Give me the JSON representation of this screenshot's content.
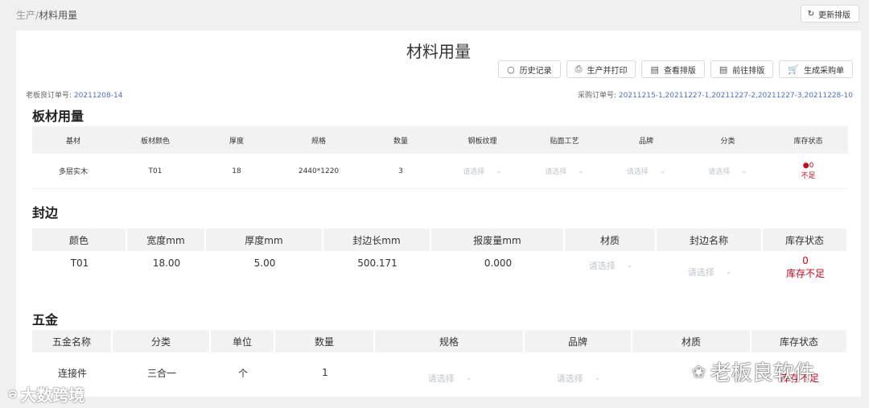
{
  "breadcrumb": {
    "parent": "生产",
    "sep": "/",
    "current": "材料用量"
  },
  "refresh_label": "更新排版",
  "page_title": "材料用量",
  "toolbar": [
    {
      "label": "历史记录",
      "icon": "history-icon",
      "glyph": "○"
    },
    {
      "label": "生产并打印",
      "icon": "printer-icon",
      "glyph": "⎙"
    },
    {
      "label": "查看排版",
      "icon": "layout-icon",
      "glyph": "▤"
    },
    {
      "label": "前往排版",
      "icon": "layout-icon",
      "glyph": "▤"
    },
    {
      "label": "生成采购单",
      "icon": "cart-icon",
      "glyph": "🛒"
    }
  ],
  "order": {
    "label": "老板良订单号:",
    "value": "20211208-14",
    "purchase_label": "采购订单号:",
    "purchase_value": "20211215-1,20211227-1,20211227-2,20211227-3,20211228-10"
  },
  "board": {
    "title": "板材用量",
    "headers": [
      "基材",
      "板材颜色",
      "厚度",
      "规格",
      "数量",
      "钢板纹理",
      "贴面工艺",
      "品牌",
      "分类",
      "库存状态"
    ],
    "rows": [
      {
        "base": "多层实木",
        "color": "T01",
        "thickness": "18",
        "spec": "2440*1220",
        "qty": "3",
        "select1": "请选择",
        "select2": "请选择",
        "select3": "请选择",
        "select4": "请选择",
        "stock_value": "0",
        "stock_text": "不足"
      }
    ]
  },
  "edge": {
    "title": "封边",
    "headers": [
      "颜色",
      "宽度mm",
      "厚度mm",
      "封边长mm",
      "报废量mm",
      "材质",
      "封边名称",
      "库存状态"
    ],
    "rows": [
      {
        "color": "T01",
        "width": "18.00",
        "thickness": "5.00",
        "length": "500.171",
        "waste": "0.000",
        "select1": "请选择",
        "select2": "请选择",
        "stock_value": "0",
        "stock_text": "库存不足"
      }
    ]
  },
  "hardware": {
    "title": "五金",
    "headers": [
      "五金名称",
      "分类",
      "单位",
      "数量",
      "规格",
      "品牌",
      "材质",
      "库存状态"
    ],
    "rows": [
      {
        "name": "连接件",
        "category": "三合一",
        "unit": "个",
        "qty": "1",
        "select1": "请选择",
        "select2": "请选择",
        "stock_text": "库存不足"
      }
    ]
  },
  "watermarks": {
    "left": "大数跨境",
    "right": "老板良软件"
  },
  "colors": {
    "link": "#4a6fd0",
    "danger": "#d0021b",
    "header_bg": "#f2f2f2"
  }
}
